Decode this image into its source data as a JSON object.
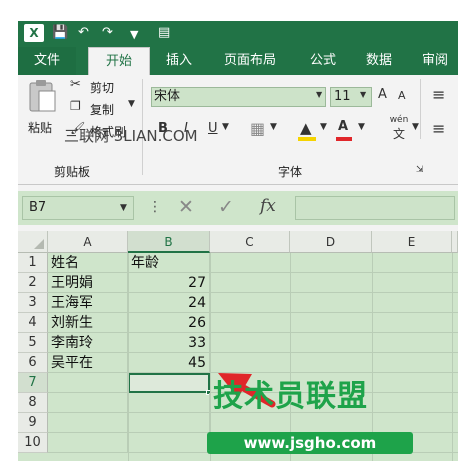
{
  "quick_access": {
    "app_icon": "X",
    "save_icon": "save-icon",
    "undo_icon": "undo-icon",
    "redo_icon": "redo-icon"
  },
  "tabs": [
    {
      "label": "文件"
    },
    {
      "label": "开始"
    },
    {
      "label": "插入"
    },
    {
      "label": "页面布局"
    },
    {
      "label": "公式"
    },
    {
      "label": "数据"
    },
    {
      "label": "审阅"
    }
  ],
  "ribbon": {
    "paste": "粘贴",
    "cut": "剪切",
    "copy": "复制",
    "format_painter": "格式刷",
    "clipboard_group": "剪贴板",
    "font_name": "宋体",
    "font_size": "11",
    "font_group": "字体",
    "bold": "B",
    "italic": "I",
    "underline": "U",
    "font_color": "A",
    "grow": "A",
    "shrink": "A",
    "phonetic": "wén",
    "phonetic_char": "文",
    "watermark": "三联网 3LIAN.COM"
  },
  "formula_bar": {
    "name_box": "B7",
    "fx": "fx",
    "value": ""
  },
  "columns": [
    "A",
    "B",
    "C",
    "D",
    "E"
  ],
  "rows": [
    {
      "num": "1",
      "a": "姓名",
      "b": "年龄"
    },
    {
      "num": "2",
      "a": "王明娟",
      "b": "27"
    },
    {
      "num": "3",
      "a": "王海军",
      "b": "24"
    },
    {
      "num": "4",
      "a": "刘新生",
      "b": "26"
    },
    {
      "num": "5",
      "a": "李南玲",
      "b": "33"
    },
    {
      "num": "6",
      "a": "吴平在",
      "b": "45"
    },
    {
      "num": "7",
      "a": "",
      "b": ""
    },
    {
      "num": "8",
      "a": "",
      "b": ""
    },
    {
      "num": "9",
      "a": "",
      "b": ""
    },
    {
      "num": "10",
      "a": "",
      "b": ""
    }
  ],
  "overlay": {
    "brand": "技术员联盟",
    "url": "www.jsgho.com"
  },
  "colors": {
    "excel_green": "#217346",
    "sheet_tint": "#cfe5cb",
    "brand_green": "#1ea34a",
    "arrow_red": "#e0262a"
  }
}
